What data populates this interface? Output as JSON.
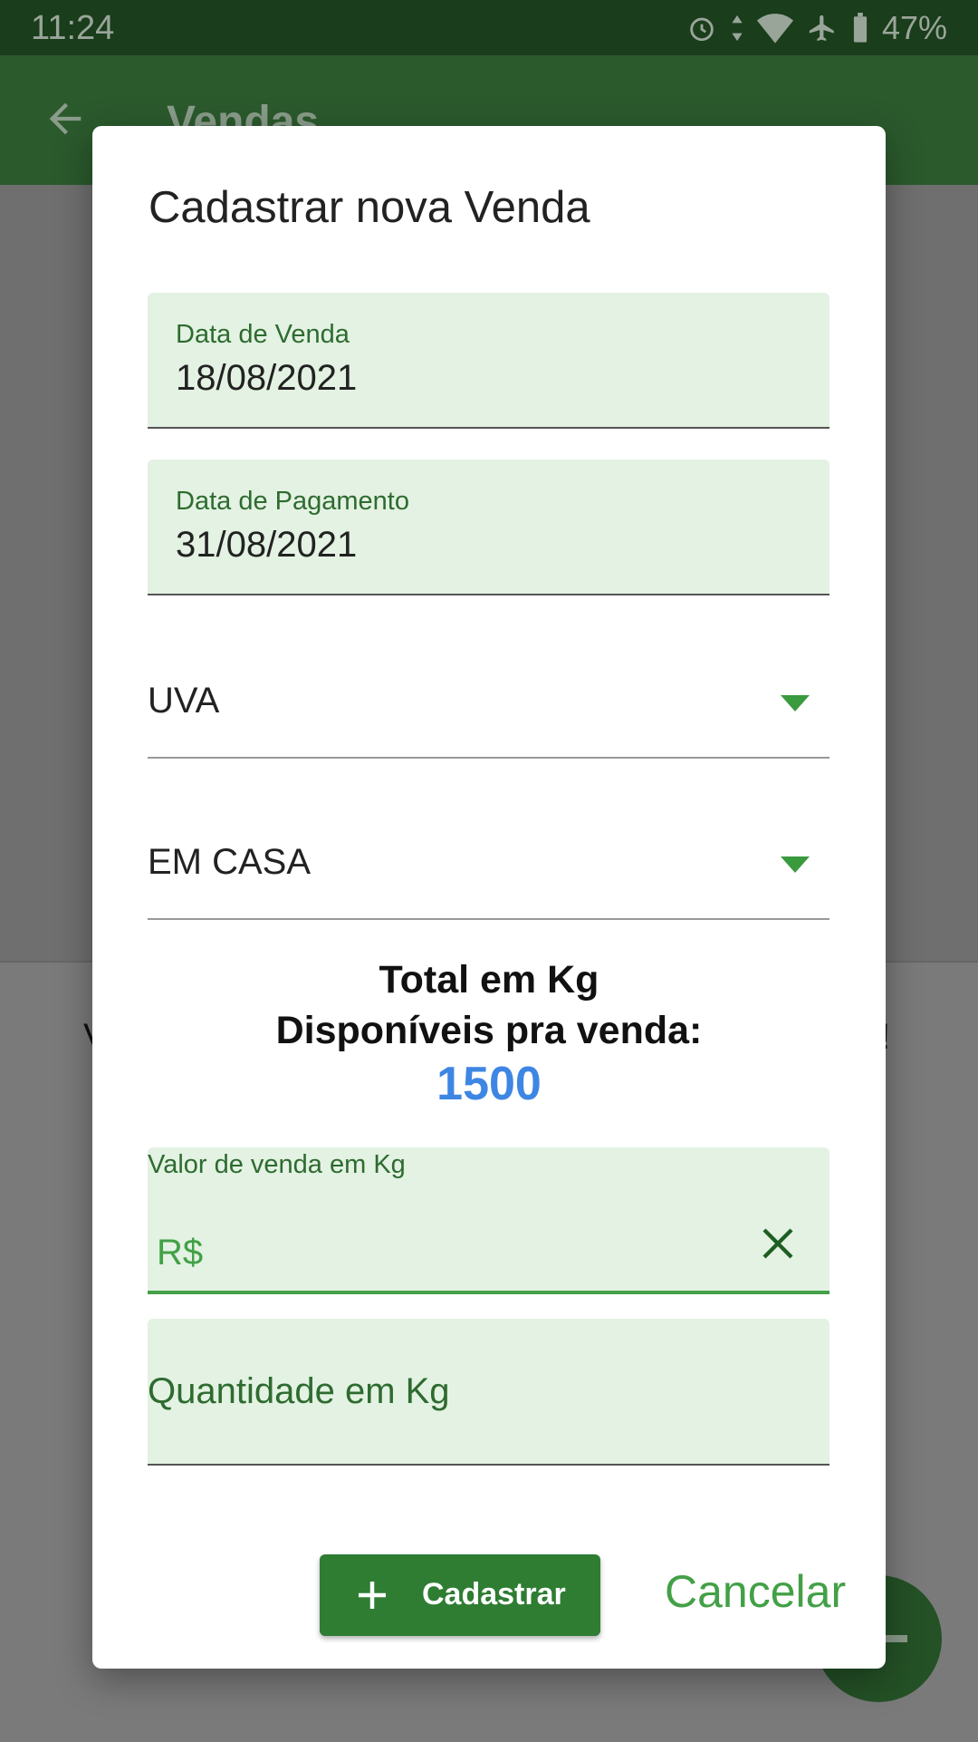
{
  "status_bar": {
    "time": "11:24",
    "battery": "47%"
  },
  "app_bar": {
    "title": "Vendas"
  },
  "background": {
    "left_fragment": "V",
    "right_fragment": "!"
  },
  "dialog": {
    "title": "Cadastrar nova Venda",
    "sale_date": {
      "label": "Data de Venda",
      "value": "18/08/2021"
    },
    "payment_date": {
      "label": "Data de Pagamento",
      "value": "31/08/2021"
    },
    "product_select": {
      "value": "UVA"
    },
    "location_select": {
      "value": "EM CASA"
    },
    "total": {
      "line1": "Total em Kg",
      "line2": "Disponíveis pra venda:",
      "value": "1500"
    },
    "price_field": {
      "label": "Valor de venda em Kg",
      "prefix": "R$"
    },
    "quantity_field": {
      "placeholder": "Quantidade em Kg"
    },
    "submit_label": "Cadastrar",
    "cancel_label": "Cancelar"
  },
  "colors": {
    "primary": "#2e7d32",
    "accent_green": "#43a047",
    "field_bg": "#e3f2e2",
    "total_value": "#3e86e3"
  }
}
